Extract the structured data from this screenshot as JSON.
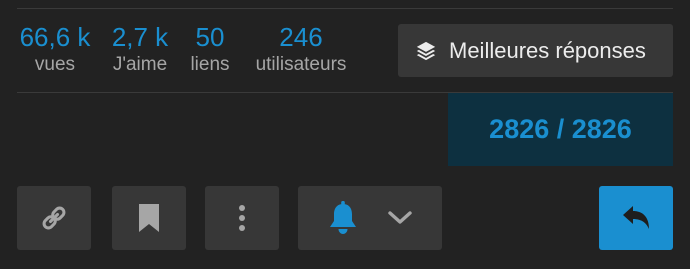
{
  "stats": {
    "views": {
      "value": "66,6 k",
      "label": "vues"
    },
    "likes": {
      "value": "2,7 k",
      "label": "J'aime"
    },
    "links": {
      "value": "50",
      "label": "liens"
    },
    "users": {
      "value": "246",
      "label": "utilisateurs"
    }
  },
  "best_answers_button": {
    "label": "Meilleures réponses",
    "icon": "layers-icon"
  },
  "progress": {
    "text": "2826 / 2826",
    "current": 2826,
    "total": 2826
  },
  "actions": {
    "share_icon": "link-icon",
    "bookmark_icon": "bookmark-icon",
    "more_icon": "more-vertical-icon",
    "notification_icon": "bell-icon",
    "notification_dropdown_icon": "chevron-down-icon",
    "reply_icon": "reply-icon"
  },
  "colors": {
    "background": "#222222",
    "accent": "#1a8fd0",
    "button": "#373737",
    "progress_bg": "#0d3040",
    "muted_text": "#a6a6a6"
  }
}
